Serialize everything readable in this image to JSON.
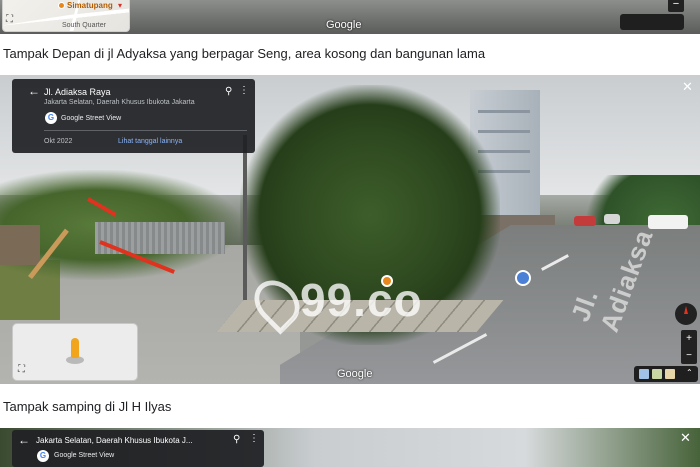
{
  "top_view": {
    "place_label": "Simatupang",
    "area_label": "South Quarter",
    "google_label": "Google",
    "zoom_out_label": "−"
  },
  "captions": {
    "first": "Tampak Depan di jl Adyaksa yang berpagar Seng, area kosong dan bangunan lama",
    "second": "Tampak samping di Jl H Ilyas"
  },
  "main_view": {
    "title": "Jl. Adiaksa Raya",
    "subtitle": "Jakarta Selatan, Daerah Khusus Ibukota Jakarta",
    "service_label": "Google Street View",
    "capture_date": "Okt 2022",
    "see_more_label": "Lihat tanggal lainnya",
    "road_marking": "Jl. Adiaksa",
    "watermark": "99.co",
    "google_label": "Google",
    "zoom_in_label": "+",
    "zoom_out_label": "−",
    "close_label": "✕"
  },
  "bottom_view": {
    "subtitle": "Jakarta Selatan, Daerah Khusus Ibukota J...",
    "service_label": "Google Street View",
    "close_label": "✕"
  },
  "icons": {
    "back": "←",
    "pin": "⚲",
    "more": "⋮",
    "expand": "⛶"
  },
  "colors": {
    "panel_bg": "#202124",
    "link": "#8ab4f8",
    "annotation_arrow": "#e0331f",
    "peg": "#f0a51c"
  }
}
